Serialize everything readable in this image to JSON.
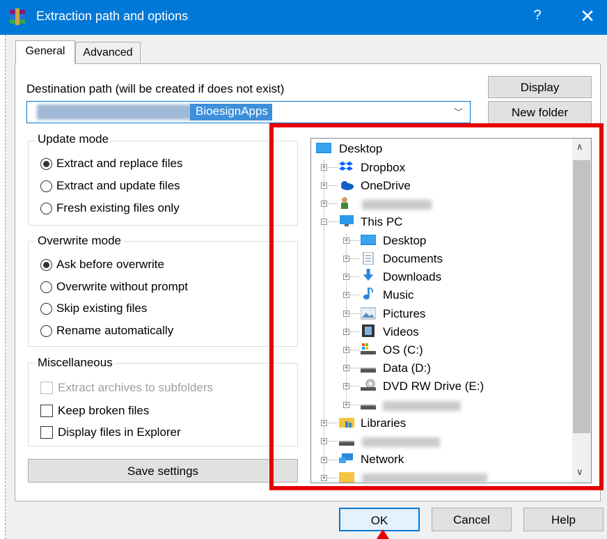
{
  "window": {
    "title": "Extraction path and options",
    "help_glyph": "?",
    "close_glyph": "✕"
  },
  "tabs": [
    {
      "label": "General",
      "active": true
    },
    {
      "label": "Advanced",
      "active": false
    }
  ],
  "destination": {
    "label": "Destination path (will be created if does not exist)",
    "value_visible": "BioesignApps",
    "display_button": "Display",
    "new_folder_button": "New folder"
  },
  "update_mode": {
    "title": "Update mode",
    "options": [
      {
        "label": "Extract and replace files",
        "selected": true
      },
      {
        "label": "Extract and update files",
        "selected": false
      },
      {
        "label": "Fresh existing files only",
        "selected": false
      }
    ]
  },
  "overwrite_mode": {
    "title": "Overwrite mode",
    "options": [
      {
        "label": "Ask before overwrite",
        "selected": true
      },
      {
        "label": "Overwrite without prompt",
        "selected": false
      },
      {
        "label": "Skip existing files",
        "selected": false
      },
      {
        "label": "Rename automatically",
        "selected": false
      }
    ]
  },
  "miscellaneous": {
    "title": "Miscellaneous",
    "options": [
      {
        "label": "Extract archives to subfolders",
        "checked": false,
        "disabled": true
      },
      {
        "label": "Keep broken files",
        "checked": false,
        "disabled": false
      },
      {
        "label": "Display files in Explorer",
        "checked": false,
        "disabled": false
      }
    ]
  },
  "save_settings_button": "Save settings",
  "tree": {
    "items": [
      {
        "label": "Desktop",
        "icon": "desktop-icon"
      },
      {
        "label": "Dropbox",
        "icon": "dropbox-icon"
      },
      {
        "label": "OneDrive",
        "icon": "onedrive-icon"
      },
      {
        "label": "",
        "icon": "user-icon"
      },
      {
        "label": "This PC",
        "icon": "this-pc-icon"
      },
      {
        "label": "Desktop",
        "icon": "desktop-icon"
      },
      {
        "label": "Documents",
        "icon": "documents-icon"
      },
      {
        "label": "Downloads",
        "icon": "downloads-icon"
      },
      {
        "label": "Music",
        "icon": "music-icon"
      },
      {
        "label": "Pictures",
        "icon": "pictures-icon"
      },
      {
        "label": "Videos",
        "icon": "videos-icon"
      },
      {
        "label": "OS (C:)",
        "icon": "os-drive-icon"
      },
      {
        "label": "Data (D:)",
        "icon": "drive-icon"
      },
      {
        "label": "DVD RW Drive (E:)",
        "icon": "dvd-drive-icon"
      },
      {
        "label": "",
        "icon": "drive-icon"
      },
      {
        "label": "Libraries",
        "icon": "libraries-icon"
      },
      {
        "label": "",
        "icon": "drive-icon"
      },
      {
        "label": "Network",
        "icon": "network-icon"
      },
      {
        "label": "",
        "icon": "folder-icon"
      }
    ]
  },
  "footer": {
    "ok_button": "OK",
    "cancel_button": "Cancel",
    "help_button": "Help"
  },
  "colors": {
    "titlebar": "#0078d7",
    "highlight": "#e80000",
    "selection": "#3d8fdc"
  }
}
